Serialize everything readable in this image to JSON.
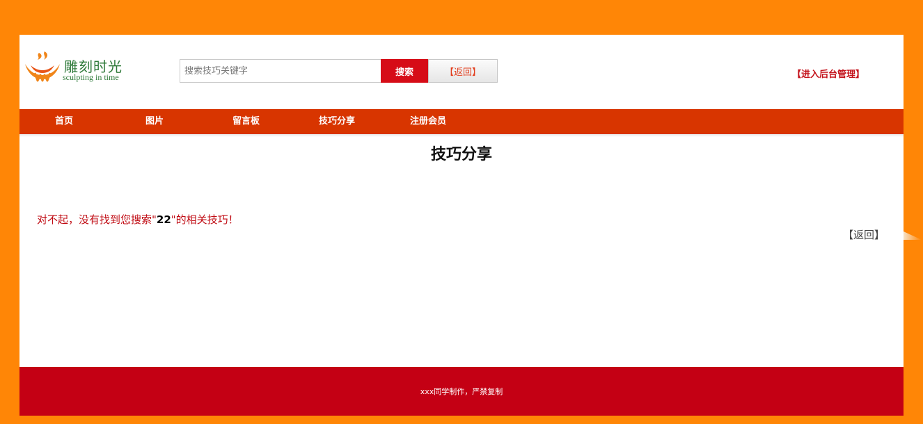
{
  "colors": {
    "background": "#ff8606",
    "nav_bg": "#d83500",
    "search_button": "#d60c17",
    "footer_bg": "#c40014",
    "accent_red": "#c4121b",
    "logo_green": "#2f7a3a",
    "logo_orange": "#f08519"
  },
  "logo": {
    "icon": "flame-logo-icon",
    "name_cn": "雕刻时光",
    "name_en": "sculpting in time"
  },
  "search": {
    "placeholder": "搜索技巧关键字",
    "button_label": "搜索",
    "back_label": "【返回】"
  },
  "header": {
    "admin_link": "【进入后台管理】"
  },
  "nav": {
    "items": [
      {
        "label": "首页"
      },
      {
        "label": "图片"
      },
      {
        "label": "留言板"
      },
      {
        "label": "技巧分享"
      },
      {
        "label": "注册会员"
      }
    ]
  },
  "content": {
    "title": "技巧分享",
    "msg_prefix": "对不起，没有找到您搜索\"",
    "search_term": "22",
    "msg_suffix": "\"的相关技巧！",
    "back_link": "【返回】"
  },
  "footer": {
    "text": "xxx同学制作，严禁复制"
  }
}
